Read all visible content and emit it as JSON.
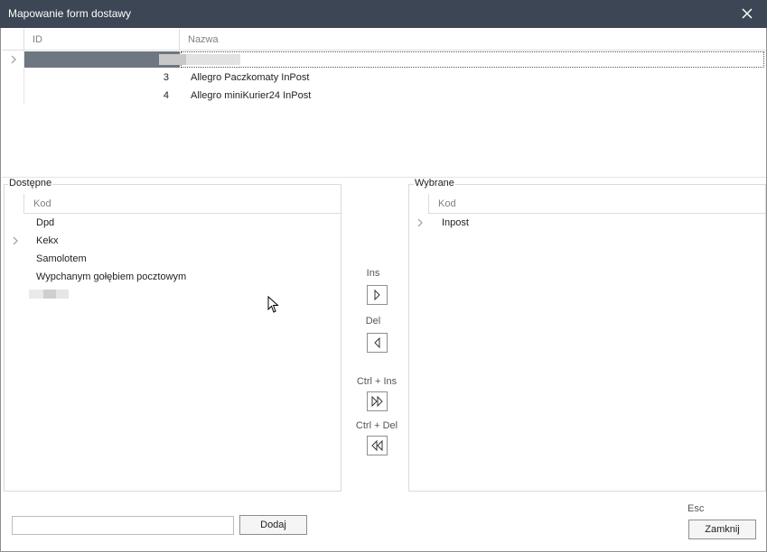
{
  "window": {
    "title": "Mapowanie form dostawy"
  },
  "top_grid": {
    "columns": [
      "ID",
      "Nazwa"
    ],
    "rows": [
      {
        "id": "",
        "name": ""
      },
      {
        "id": "3",
        "name": "Allegro Paczkomaty InPost"
      },
      {
        "id": "4",
        "name": "Allegro miniKurier24 InPost"
      }
    ]
  },
  "available": {
    "label": "Dostępne",
    "column": "Kod",
    "items": [
      "Dpd",
      "Kekx",
      "Samolotem",
      "Wypchanym gołębiem pocztowym"
    ]
  },
  "selected": {
    "label": "Wybrane",
    "column": "Kod",
    "items": [
      "Inpost"
    ]
  },
  "transfer": {
    "add_one_shortcut": "Ins",
    "remove_one_shortcut": "Del",
    "add_all_shortcut": "Ctrl + Ins",
    "remove_all_shortcut": "Ctrl + Del"
  },
  "bottom": {
    "input_value": "",
    "add_button": "Dodaj",
    "close_shortcut": "Esc",
    "close_button": "Zamknij"
  },
  "colors": {
    "titlebar": "#3c4654",
    "selected_row": "#6e7681",
    "border": "#8a8f96"
  },
  "icons": [
    "close-icon",
    "chevron-right-icon",
    "arrow-right-icon",
    "arrow-left-icon",
    "double-arrow-right-icon",
    "double-arrow-left-icon",
    "mouse-cursor-icon"
  ]
}
